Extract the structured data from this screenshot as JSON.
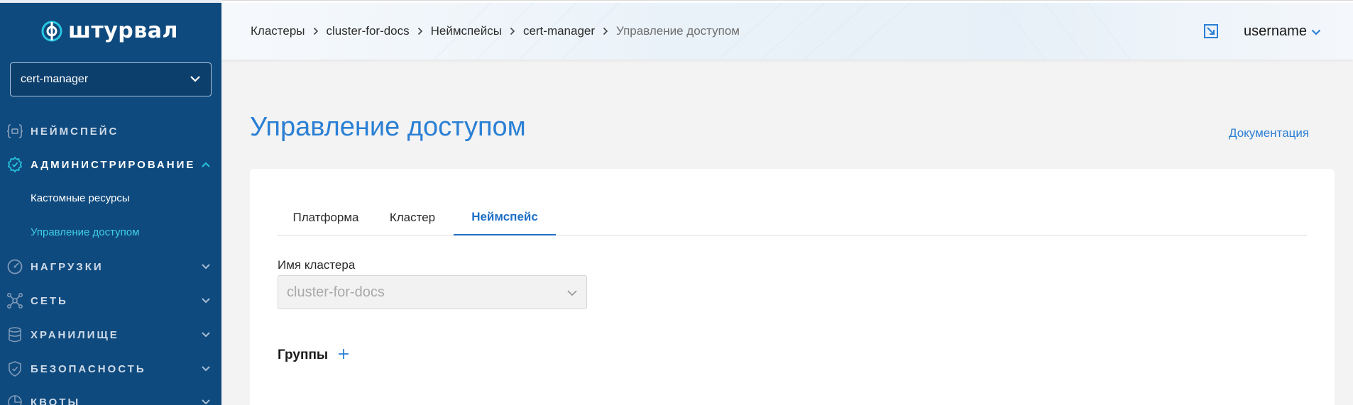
{
  "app": {
    "logo_text": "штурвал"
  },
  "sidebar": {
    "namespace_select": {
      "value": "cert-manager"
    },
    "items": [
      {
        "label": "НЕЙМСПЕЙС",
        "icon": "braces-icon"
      },
      {
        "label": "АДМИНИСТРИРОВАНИЕ",
        "icon": "gear-check-icon",
        "expanded": true,
        "children": [
          {
            "label": "Кастомные ресурсы"
          },
          {
            "label": "Управление доступом",
            "active": true
          }
        ]
      },
      {
        "label": "НАГРУЗКИ",
        "icon": "gauge-icon"
      },
      {
        "label": "СЕТЬ",
        "icon": "network-icon"
      },
      {
        "label": "ХРАНИЛИЩЕ",
        "icon": "database-icon"
      },
      {
        "label": "БЕЗОПАСНОСТЬ",
        "icon": "shield-icon"
      },
      {
        "label": "КВОТЫ",
        "icon": "pie-icon"
      }
    ]
  },
  "header": {
    "breadcrumb": [
      "Кластеры",
      "cluster-for-docs",
      "Неймспейсы",
      "cert-manager",
      "Управление доступом"
    ],
    "username": "username"
  },
  "main": {
    "title": "Управление доступом",
    "docs_link": "Документация",
    "tabs": [
      {
        "label": "Платформа"
      },
      {
        "label": "Кластер"
      },
      {
        "label": "Неймспейс",
        "active": true
      }
    ],
    "cluster_field": {
      "label": "Имя кластера",
      "value": "cluster-for-docs"
    },
    "groups": {
      "title": "Группы"
    }
  },
  "colors": {
    "sidebar_bg": "#0f4a7e",
    "accent": "#2a7fd4",
    "active_sub": "#3fd0e6"
  }
}
